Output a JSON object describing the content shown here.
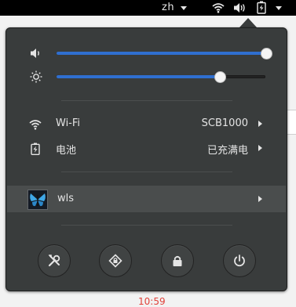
{
  "topbar": {
    "language": "zh",
    "icons": [
      "wifi-icon",
      "volume-icon",
      "battery-charging-icon"
    ]
  },
  "menu": {
    "volume": {
      "icon": "volume-icon",
      "level": 1.0
    },
    "brightness": {
      "icon": "brightness-icon",
      "level": 0.78
    },
    "wifi": {
      "icon": "wifi-icon",
      "label": "Wi-Fi",
      "value": "SCB1000"
    },
    "battery": {
      "icon": "battery-charging-icon",
      "label": "电池",
      "value": "已充满电"
    },
    "user": {
      "icon": "avatar",
      "name": "wls"
    },
    "actions": [
      {
        "name": "settings-icon"
      },
      {
        "name": "lock-rotation-icon"
      },
      {
        "name": "lock-icon"
      },
      {
        "name": "power-icon"
      }
    ]
  },
  "background": {
    "clock_fragment": "10:59"
  },
  "colors": {
    "menu_bg": "#393c3c",
    "accent": "#2f6fd0",
    "topbar": "#000000"
  }
}
